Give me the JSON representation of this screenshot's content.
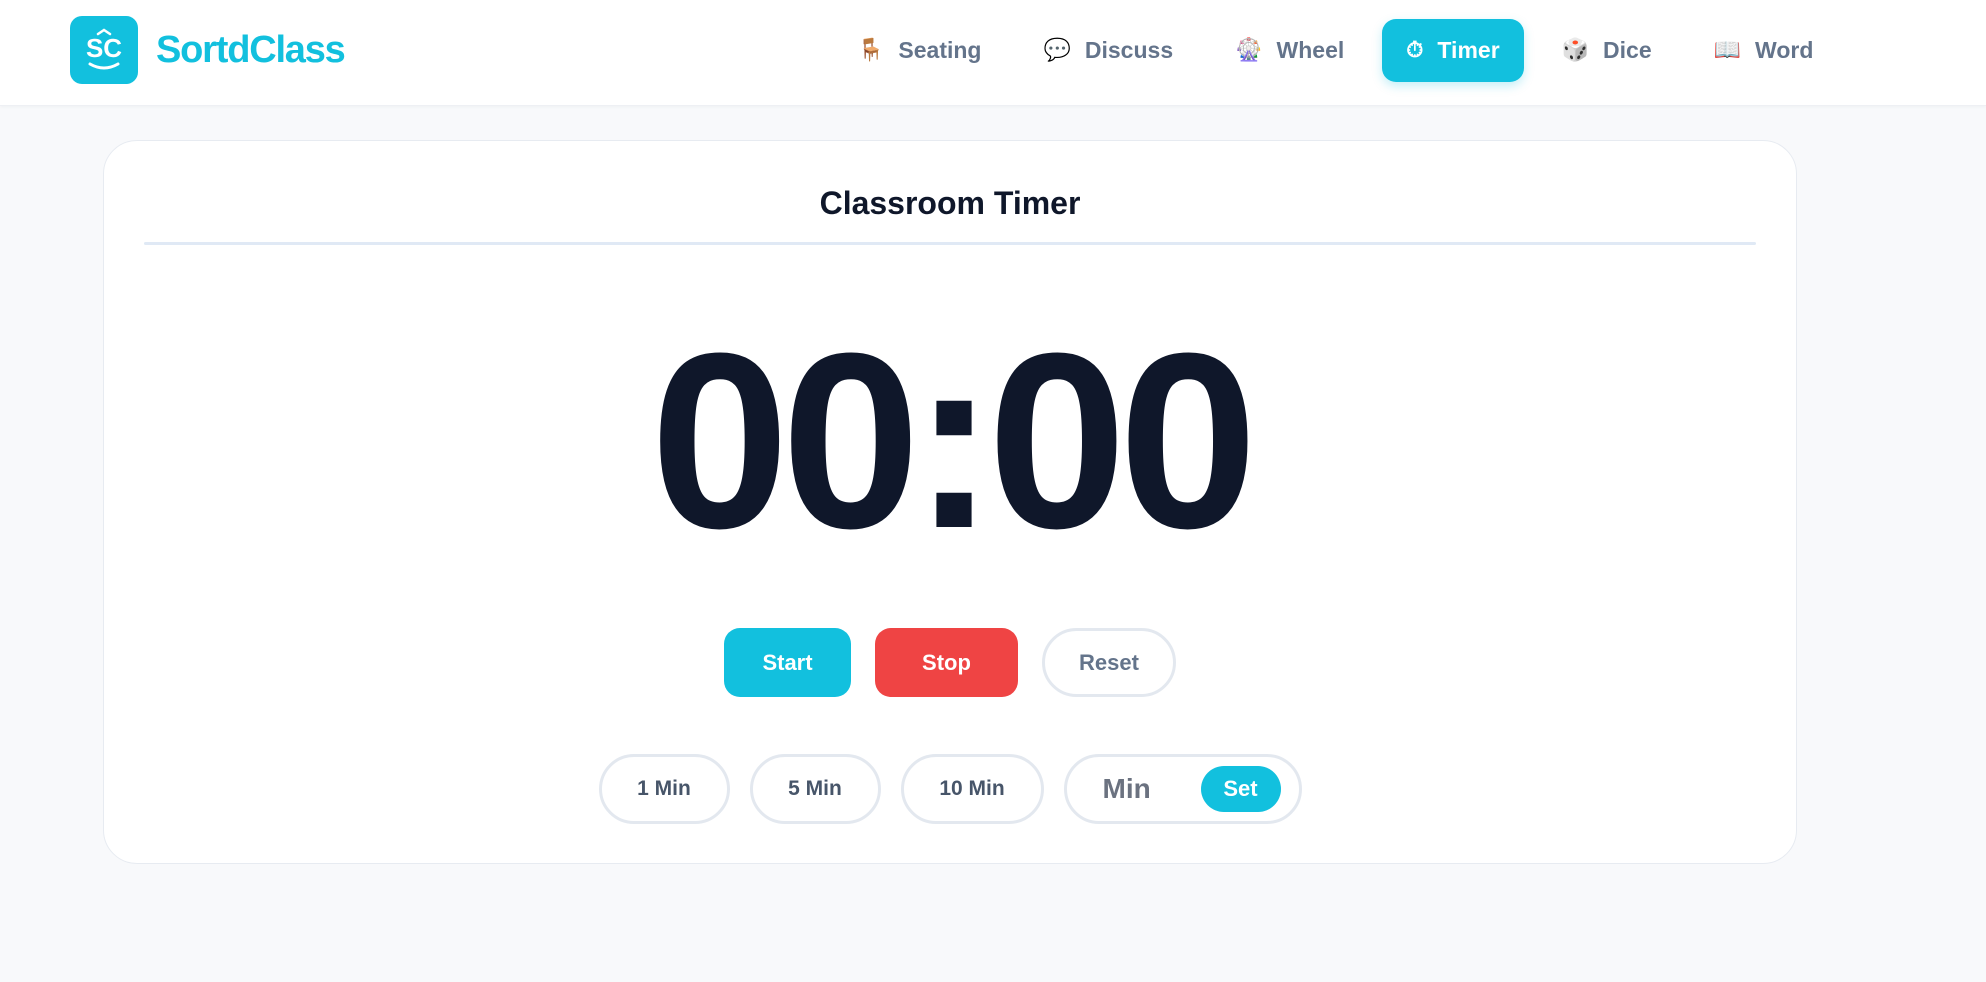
{
  "brand": {
    "name": "SortdClass",
    "logo_text": "SC",
    "color": "#12c0de"
  },
  "nav": {
    "items": [
      {
        "label": "Seating",
        "icon": "chair-icon",
        "glyph": "🪑",
        "active": false
      },
      {
        "label": "Discuss",
        "icon": "speech-bubble-icon",
        "glyph": "💬",
        "active": false
      },
      {
        "label": "Wheel",
        "icon": "ferris-wheel-icon",
        "glyph": "🎡",
        "active": false
      },
      {
        "label": "Timer",
        "icon": "stopwatch-icon",
        "glyph": "⏱",
        "active": true
      },
      {
        "label": "Dice",
        "icon": "dice-icon",
        "glyph": "🎲",
        "active": false
      },
      {
        "label": "Word",
        "icon": "book-icon",
        "glyph": "📖",
        "active": false
      }
    ]
  },
  "timer": {
    "title": "Classroom Timer",
    "display": "00:00",
    "start_label": "Start",
    "stop_label": "Stop",
    "reset_label": "Reset",
    "presets": [
      "1 Min",
      "5 Min",
      "10 Min"
    ],
    "custom_placeholder": "Min",
    "set_label": "Set"
  },
  "colors": {
    "accent": "#12c0de",
    "stop": "#ef4444",
    "text_dark": "#0f172a",
    "text_muted": "#64748b"
  }
}
